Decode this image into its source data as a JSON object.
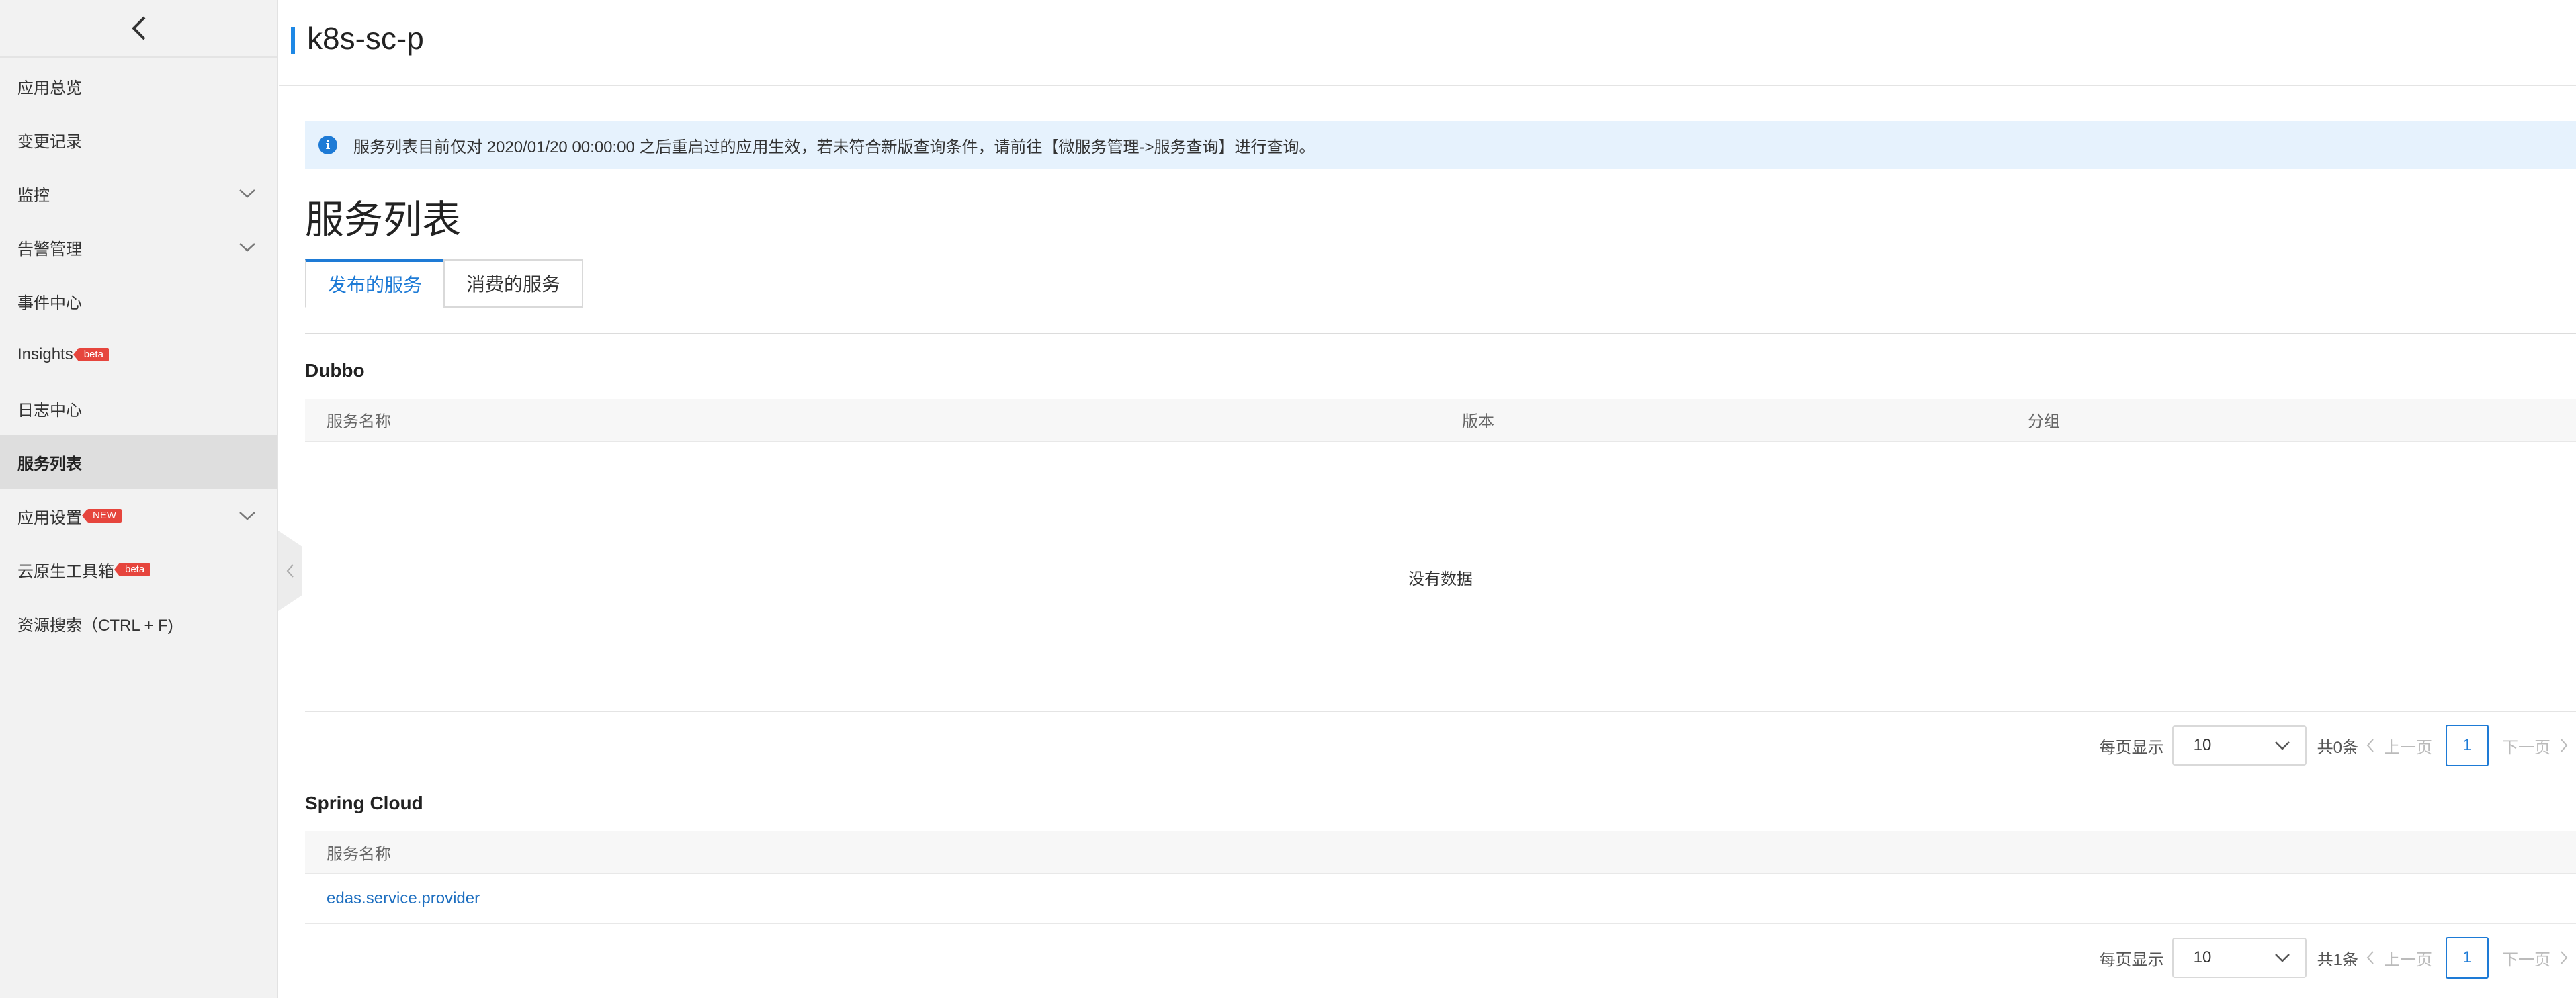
{
  "sidebar": {
    "items": [
      {
        "label": "应用总览"
      },
      {
        "label": "变更记录"
      },
      {
        "label": "监控"
      },
      {
        "label": "告警管理"
      },
      {
        "label": "事件中心"
      },
      {
        "label": "Insights",
        "badge": "beta"
      },
      {
        "label": "日志中心"
      },
      {
        "label": "服务列表"
      },
      {
        "label": "应用设置",
        "badge": "NEW"
      },
      {
        "label": "云原生工具箱",
        "badge": "beta"
      },
      {
        "label": "资源搜索（CTRL + F)"
      }
    ]
  },
  "header": {
    "title": "k8s-sc-p"
  },
  "notice": {
    "text": "服务列表目前仅对 2020/01/20 00:00:00 之后重启过的应用生效，若未符合新版查询条件，请前往【微服务管理->服务查询】进行查询。"
  },
  "page": {
    "heading": "服务列表"
  },
  "tabs": [
    {
      "label": "发布的服务"
    },
    {
      "label": "消费的服务"
    }
  ],
  "dubbo": {
    "title": "Dubbo",
    "columns": [
      "服务名称",
      "版本",
      "分组"
    ],
    "empty_text": "没有数据",
    "pagination": {
      "per_page_label": "每页显示",
      "per_page": "10",
      "total": "共0条",
      "prev": "上一页",
      "current": "1",
      "next": "下一页"
    }
  },
  "spring_cloud": {
    "title": "Spring Cloud",
    "columns": [
      "服务名称"
    ],
    "rows": [
      {
        "name": "edas.service.provider"
      }
    ],
    "pagination": {
      "per_page_label": "每页显示",
      "per_page": "10",
      "total": "共1条",
      "prev": "上一页",
      "current": "1",
      "next": "下一页"
    }
  },
  "colors": {
    "accent": "#1e7bd6",
    "badge": "#e6453d",
    "notice_bg": "#e6f2fd",
    "sidebar_bg": "#f2f2f2"
  }
}
